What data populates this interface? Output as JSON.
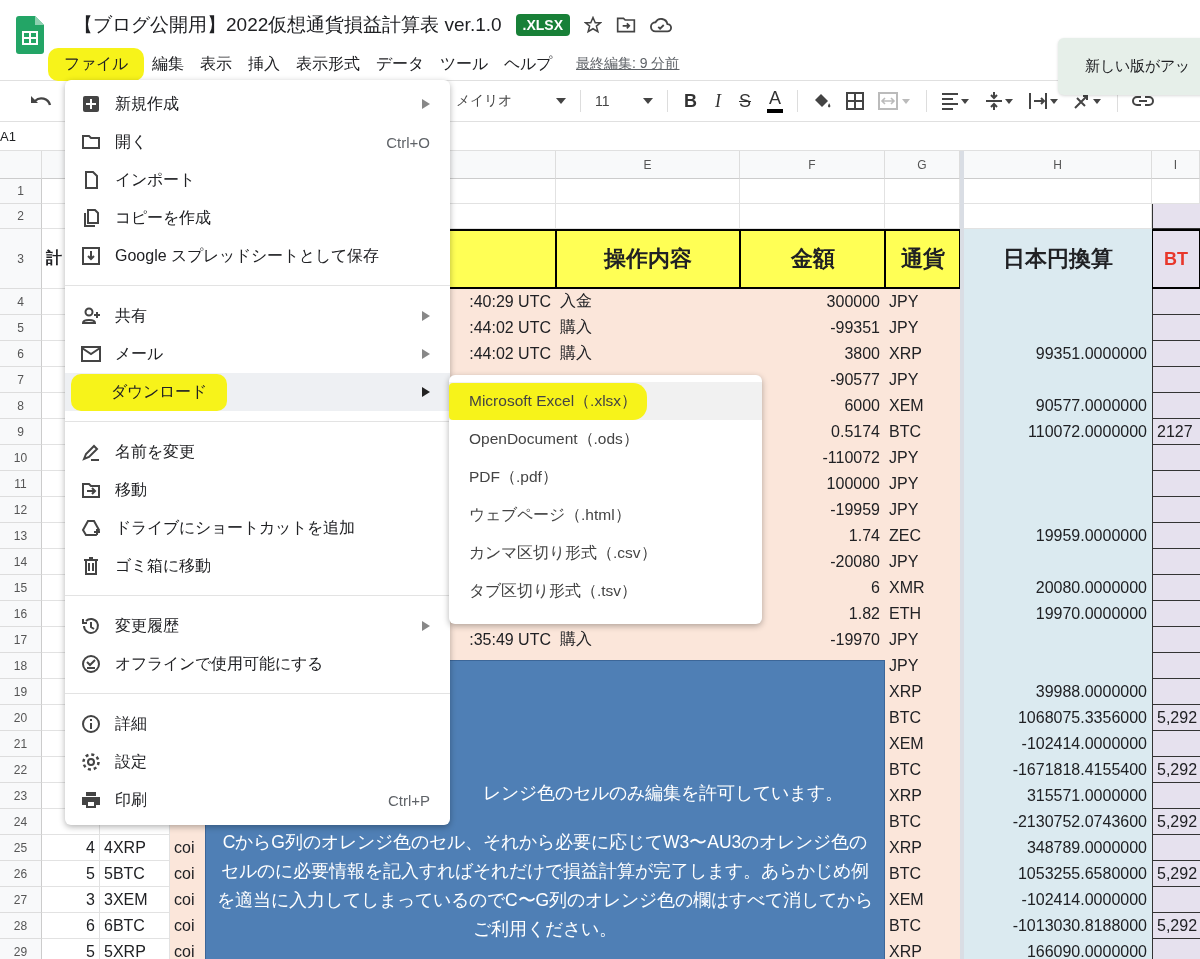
{
  "document": {
    "title": "【ブログ公開用】2022仮想通貨損益計算表 ver.1.0",
    "badge": ".XLSX"
  },
  "menu_bar": {
    "items": [
      {
        "label": "ファイル",
        "highlighted": true
      },
      {
        "label": "編集",
        "highlighted": false
      },
      {
        "label": "表示",
        "highlighted": false
      },
      {
        "label": "挿入",
        "highlighted": false
      },
      {
        "label": "表示形式",
        "highlighted": false
      },
      {
        "label": "データ",
        "highlighted": false
      },
      {
        "label": "ツール",
        "highlighted": false
      },
      {
        "label": "ヘルプ",
        "highlighted": false
      }
    ],
    "last_edit": "最終編集: 9 分前"
  },
  "toast": {
    "text": "新しい版がアッ"
  },
  "toolbar": {
    "font": "メイリオ",
    "font_size": "11",
    "format_buttons": [
      "B",
      "I",
      "S",
      "A"
    ]
  },
  "name_box": "A1",
  "file_menu": {
    "sections": [
      [
        {
          "label": "新規作成",
          "submenu": true,
          "selected": false,
          "highlighted": false
        },
        {
          "label": "開く",
          "shortcut": "Ctrl+O",
          "submenu": false,
          "selected": false,
          "highlighted": false
        },
        {
          "label": "インポート",
          "submenu": false,
          "selected": false,
          "highlighted": false
        },
        {
          "label": "コピーを作成",
          "submenu": false,
          "selected": false,
          "highlighted": false
        },
        {
          "label": "Google スプレッドシートとして保存",
          "submenu": false,
          "selected": false,
          "highlighted": false
        }
      ],
      [
        {
          "label": "共有",
          "submenu": true,
          "selected": false,
          "highlighted": false
        },
        {
          "label": "メール",
          "submenu": true,
          "selected": false,
          "highlighted": false
        },
        {
          "label": "ダウンロード",
          "submenu": true,
          "selected": true,
          "highlighted": true
        }
      ],
      [
        {
          "label": "名前を変更",
          "submenu": false,
          "selected": false,
          "highlighted": false
        },
        {
          "label": "移動",
          "submenu": false,
          "selected": false,
          "highlighted": false
        },
        {
          "label": "ドライブにショートカットを追加",
          "submenu": false,
          "selected": false,
          "highlighted": false
        },
        {
          "label": "ゴミ箱に移動",
          "submenu": false,
          "selected": false,
          "highlighted": false
        }
      ],
      [
        {
          "label": "変更履歴",
          "submenu": true,
          "selected": false,
          "highlighted": false
        },
        {
          "label": "オフラインで使用可能にする",
          "submenu": false,
          "selected": false,
          "highlighted": false
        }
      ],
      [
        {
          "label": "詳細",
          "submenu": false,
          "selected": false,
          "highlighted": false
        },
        {
          "label": "設定",
          "submenu": false,
          "selected": false,
          "highlighted": false
        },
        {
          "label": "印刷",
          "shortcut": "Ctrl+P",
          "submenu": false,
          "selected": false,
          "highlighted": false
        }
      ]
    ]
  },
  "download_submenu": {
    "items": [
      {
        "label": "Microsoft Excel（.xlsx）",
        "selected": true,
        "highlighted": true
      },
      {
        "label": "OpenDocument（.ods）",
        "selected": false,
        "highlighted": false
      },
      {
        "label": "PDF（.pdf）",
        "selected": false,
        "highlighted": false
      },
      {
        "label": "ウェブページ（.html）",
        "selected": false,
        "highlighted": false
      },
      {
        "label": "カンマ区切り形式（.csv）",
        "selected": false,
        "highlighted": false
      },
      {
        "label": "タブ区切り形式（.tsv）",
        "selected": false,
        "highlighted": false
      }
    ]
  },
  "sheet": {
    "column_headers": [
      "E",
      "F",
      "G",
      "H",
      "I"
    ],
    "rows": [
      {
        "number": "1",
        "kind": "blank",
        "cells": {}
      },
      {
        "number": "2",
        "kind": "blank",
        "cells": {}
      },
      {
        "number": "3",
        "kind": "header",
        "cells": {
          "B": "計",
          "E": "操作内容",
          "F": "金額",
          "G": "通貨",
          "H": "日本円換算",
          "I": "BT"
        }
      },
      {
        "number": "4",
        "kind": "data",
        "cells": {
          "D": ":40:29 UTC",
          "E": "入金",
          "F": "300000",
          "G": "JPY"
        }
      },
      {
        "number": "5",
        "kind": "data",
        "cells": {
          "D": ":44:02 UTC",
          "E": "購入",
          "F": "-99351",
          "G": "JPY"
        }
      },
      {
        "number": "6",
        "kind": "data",
        "cells": {
          "D": ":44:02 UTC",
          "E": "購入",
          "F": "3800",
          "G": "XRP",
          "H": "99351.0000000"
        }
      },
      {
        "number": "7",
        "kind": "data",
        "cells": {
          "F": "-90577",
          "G": "JPY"
        }
      },
      {
        "number": "8",
        "kind": "data",
        "cells": {
          "F": "6000",
          "G": "XEM",
          "H": "90577.0000000"
        }
      },
      {
        "number": "9",
        "kind": "data",
        "cells": {
          "F": "0.5174",
          "G": "BTC",
          "H": "110072.0000000",
          "I": "2127"
        }
      },
      {
        "number": "10",
        "kind": "data",
        "cells": {
          "F": "-110072",
          "G": "JPY"
        }
      },
      {
        "number": "11",
        "kind": "data",
        "cells": {
          "F": "100000",
          "G": "JPY"
        }
      },
      {
        "number": "12",
        "kind": "data",
        "cells": {
          "F": "-19959",
          "G": "JPY"
        }
      },
      {
        "number": "13",
        "kind": "data",
        "cells": {
          "F": "1.74",
          "G": "ZEC",
          "H": "19959.0000000"
        }
      },
      {
        "number": "14",
        "kind": "data",
        "cells": {
          "F": "-20080",
          "G": "JPY"
        }
      },
      {
        "number": "15",
        "kind": "data",
        "cells": {
          "F": "6",
          "G": "XMR",
          "H": "20080.0000000"
        }
      },
      {
        "number": "16",
        "kind": "data",
        "cells": {
          "F": "1.82",
          "G": "ETH",
          "H": "19970.0000000"
        }
      },
      {
        "number": "17",
        "kind": "data",
        "cells": {
          "D": ":35:49 UTC",
          "E": "購入",
          "F": "-19970",
          "G": "JPY"
        }
      },
      {
        "number": "18",
        "kind": "data",
        "cells": {
          "G": "JPY"
        }
      },
      {
        "number": "19",
        "kind": "data",
        "cells": {
          "G": "XRP",
          "H": "39988.0000000"
        }
      },
      {
        "number": "20",
        "kind": "data",
        "cells": {
          "G": "BTC",
          "H": "1068075.3356000",
          "I": "5,292"
        }
      },
      {
        "number": "21",
        "kind": "data",
        "cells": {
          "G": "XEM",
          "H": "-102414.0000000"
        }
      },
      {
        "number": "22",
        "kind": "data",
        "cells": {
          "G": "BTC",
          "H": "-1671818.4155400",
          "I": "5,292"
        }
      },
      {
        "number": "23",
        "kind": "data",
        "cells": {
          "G": "XRP",
          "H": "315571.0000000"
        }
      },
      {
        "number": "24",
        "kind": "record",
        "cells": {
          "G": "BTC",
          "H": "-2130752.0743600",
          "I": "5,292"
        }
      },
      {
        "number": "25",
        "kind": "record",
        "cells": {
          "B": "4",
          "C": "4XRP",
          "D": "coi",
          "G": "XRP",
          "H": "348789.0000000"
        }
      },
      {
        "number": "26",
        "kind": "record",
        "cells": {
          "B": "5",
          "C": "5BTC",
          "D": "coi",
          "G": "BTC",
          "H": "1053255.6580000",
          "I": "5,292"
        }
      },
      {
        "number": "27",
        "kind": "record",
        "cells": {
          "B": "3",
          "C": "3XEM",
          "D": "coi",
          "G": "XEM",
          "H": "-102414.0000000"
        }
      },
      {
        "number": "28",
        "kind": "record",
        "cells": {
          "B": "6",
          "C": "6BTC",
          "D": "coi",
          "G": "BTC",
          "H": "-1013030.8188000",
          "I": "5,292"
        }
      },
      {
        "number": "29",
        "kind": "record",
        "cells": {
          "B": "5",
          "C": "5XRP",
          "D": "coi",
          "G": "XRP",
          "H": "166090.0000000"
        }
      }
    ]
  },
  "note": {
    "paragraphs": [
      "レンジ色のセルのみ編集を許可しています。",
      "CからG列のオレンジ色のセル、それから必要に応じてW3〜AU3のオレンジ色のセルのに必要情報を記入すればそれだけで損益計算が完了します。あらかじめ例を適当に入力してしまっているのでC〜G列のオレンジ色の欄はすべて消してからご利用ください。"
    ]
  }
}
